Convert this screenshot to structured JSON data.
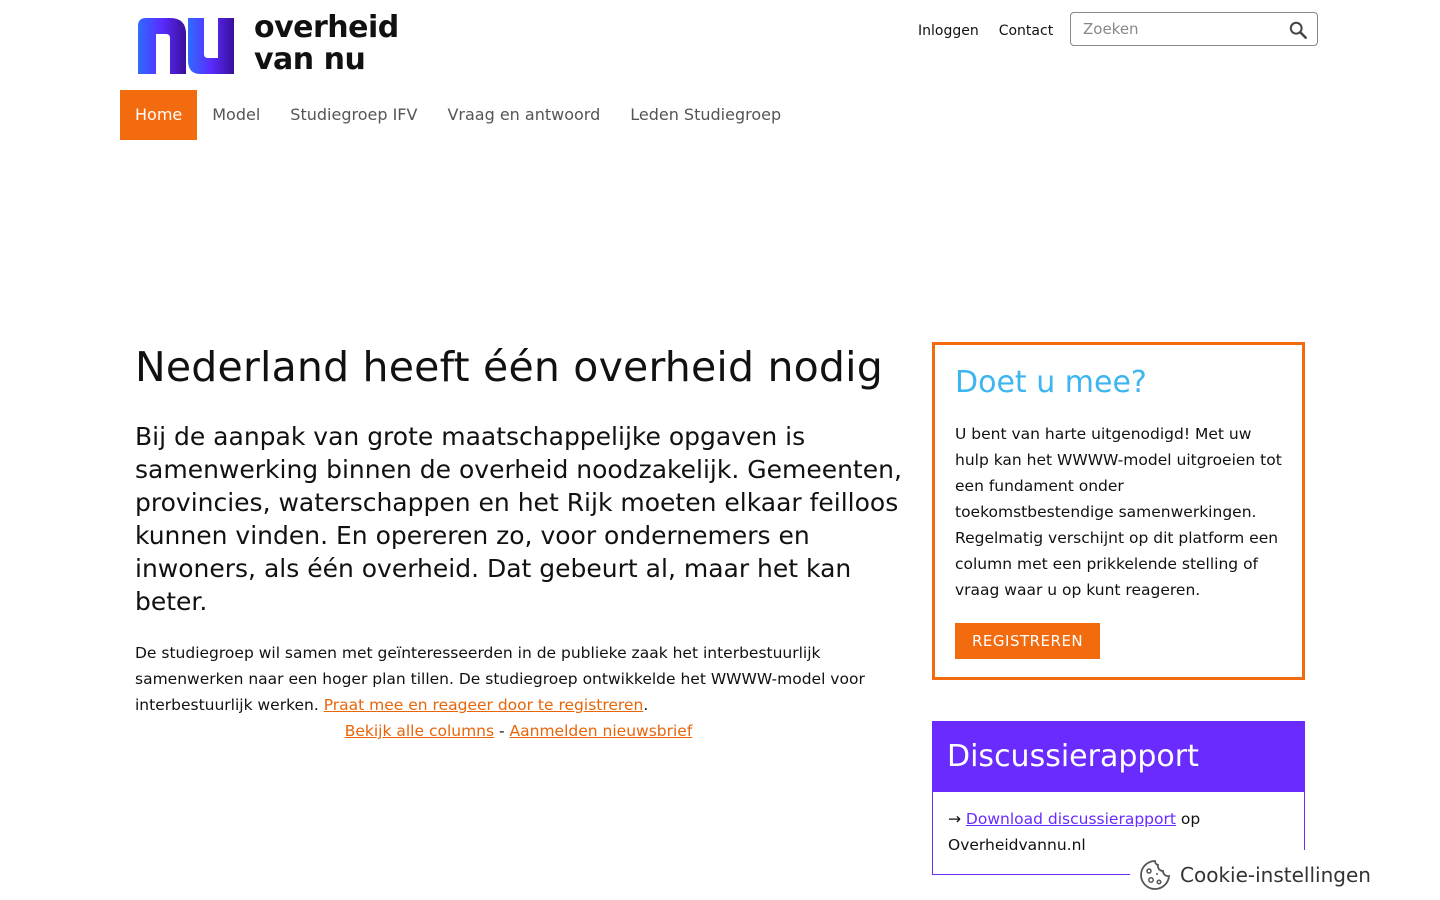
{
  "brand": {
    "logo_line1": "overheid",
    "logo_line2": "van nu",
    "logo_mark_text": "nu",
    "colors": {
      "orange": "#f26b0f",
      "purple": "#6a2bff",
      "blue": "#3db5f0"
    }
  },
  "header": {
    "login_label": "Inloggen",
    "contact_label": "Contact",
    "search_placeholder": "Zoeken",
    "search_value": ""
  },
  "nav": {
    "items": [
      {
        "label": "Home",
        "active": true
      },
      {
        "label": "Model",
        "active": false
      },
      {
        "label": "Studiegroep IFV",
        "active": false
      },
      {
        "label": "Vraag en antwoord",
        "active": false
      },
      {
        "label": "Leden Studiegroep",
        "active": false
      }
    ]
  },
  "main": {
    "title": "Nederland heeft één overheid nodig",
    "lead": "Bij de aanpak van grote maatschappelijke opgaven is samenwerking binnen de overheid noodzakelijk. Gemeenten, provincies, waterschappen en het Rijk moeten elkaar feilloos kunnen vinden. En opereren zo, voor ondernemers en inwoners, als één overheid. Dat gebeurt al, maar het kan beter.",
    "body": "De studiegroep wil samen met geïnteresseerden in de publieke zaak het interbestuurlijk samenwerken naar een hoger plan tillen. De studiegroep ontwikkelde het WWWW-model voor interbestuurlijk werken. ",
    "register_link": "Praat mee en reageer door te registreren",
    "body_end": ".",
    "columns_link": "Bekijk alle columns",
    "separator": " - ",
    "newsletter_link": "Aanmelden nieuwsbrief"
  },
  "cta": {
    "title": "Doet u mee?",
    "text": "U bent van harte uitgenodigd! Met uw hulp kan het WWWW-model uitgroeien tot een fundament onder toekomstbestendige samenwerkingen. Regelmatig verschijnt op dit platform een column met een prikkelende stelling of vraag waar u op kunt reageren.",
    "button": "REGISTREREN"
  },
  "report": {
    "title": "Discussierapport",
    "arrow": "→ ",
    "link": "Download discussierapport",
    "suffix": " op Overheidvannu.nl"
  },
  "cookie": {
    "label": "Cookie-instellingen",
    "icon": "cookie-icon"
  }
}
